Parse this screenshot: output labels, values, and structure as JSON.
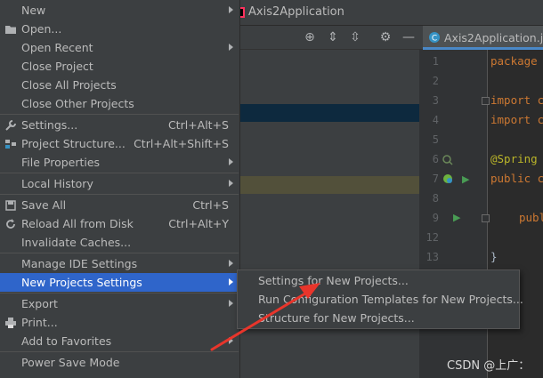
{
  "titlebar": {
    "title": "Axis2Application"
  },
  "editor": {
    "tab_label": "Axis2Application.java",
    "line_numbers": [
      "1",
      "2",
      "3",
      "4",
      "5",
      "6",
      "7",
      "8",
      "9",
      "12",
      "13"
    ],
    "code": {
      "l1": "package",
      "l3": "import c",
      "l4": "import c",
      "l6": "@Spring",
      "l7": "public c",
      "l9": "publ",
      "l13": "}"
    }
  },
  "menu": {
    "items": [
      {
        "label": "New",
        "shortcut": "",
        "submenu": true,
        "icon": ""
      },
      {
        "label": "Open...",
        "shortcut": "",
        "submenu": false,
        "icon": "folder-icon"
      },
      {
        "label": "Open Recent",
        "shortcut": "",
        "submenu": true,
        "icon": ""
      },
      {
        "label": "Close Project",
        "shortcut": "",
        "submenu": false,
        "icon": ""
      },
      {
        "label": "Close All Projects",
        "shortcut": "",
        "submenu": false,
        "icon": ""
      },
      {
        "label": "Close Other Projects",
        "shortcut": "",
        "submenu": false,
        "icon": ""
      },
      {
        "label": "Settings...",
        "shortcut": "Ctrl+Alt+S",
        "submenu": false,
        "icon": "wrench-icon"
      },
      {
        "label": "Project Structure...",
        "shortcut": "Ctrl+Alt+Shift+S",
        "submenu": false,
        "icon": "project-structure-icon"
      },
      {
        "label": "File Properties",
        "shortcut": "",
        "submenu": true,
        "icon": ""
      },
      {
        "label": "Local History",
        "shortcut": "",
        "submenu": true,
        "icon": ""
      },
      {
        "label": "Save All",
        "shortcut": "Ctrl+S",
        "submenu": false,
        "icon": "save-icon"
      },
      {
        "label": "Reload All from Disk",
        "shortcut": "Ctrl+Alt+Y",
        "submenu": false,
        "icon": "reload-icon"
      },
      {
        "label": "Invalidate Caches...",
        "shortcut": "",
        "submenu": false,
        "icon": ""
      },
      {
        "label": "Manage IDE Settings",
        "shortcut": "",
        "submenu": true,
        "icon": ""
      },
      {
        "label": "New Projects Settings",
        "shortcut": "",
        "submenu": true,
        "icon": ""
      },
      {
        "label": "Export",
        "shortcut": "",
        "submenu": true,
        "icon": ""
      },
      {
        "label": "Print...",
        "shortcut": "",
        "submenu": false,
        "icon": "print-icon"
      },
      {
        "label": "Add to Favorites",
        "shortcut": "",
        "submenu": true,
        "icon": ""
      },
      {
        "label": "Power Save Mode",
        "shortcut": "",
        "submenu": false,
        "icon": ""
      }
    ]
  },
  "submenu": {
    "items": [
      {
        "label": "Settings for New Projects..."
      },
      {
        "label": "Run Configuration Templates for New Projects..."
      },
      {
        "label": "Structure for New Projects..."
      }
    ]
  },
  "watermark": "CSDN @上广：",
  "colors": {
    "menu_bg": "#3c3f41",
    "highlight": "#2f65ca",
    "arrow": "#e8352b"
  }
}
